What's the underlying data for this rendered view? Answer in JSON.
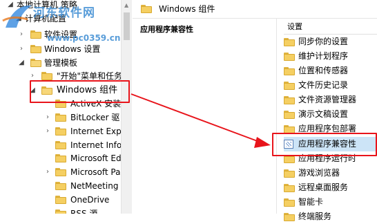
{
  "tree": {
    "items": [
      {
        "label": "本地计算机 策略",
        "expanded": true
      },
      {
        "label": "计算机配置",
        "expanded": true
      },
      {
        "label": "软件设置",
        "expanded": false
      },
      {
        "label": "Windows 设置",
        "expanded": false
      },
      {
        "label": "管理模板",
        "expanded": true
      },
      {
        "label": "\"开始\"菜单和任务",
        "expanded": false
      },
      {
        "label": "Windows 组件",
        "expanded": true
      },
      {
        "label": "ActiveX 安装",
        "expanded": false
      },
      {
        "label": "BitLocker 驱",
        "expanded": false
      },
      {
        "label": "Internet Expl",
        "expanded": false
      },
      {
        "label": "Internet Info",
        "expanded": false
      },
      {
        "label": "Microsoft Ed",
        "expanded": false
      },
      {
        "label": "Microsoft Pa",
        "expanded": false
      },
      {
        "label": "NetMeeting",
        "expanded": false
      },
      {
        "label": "OneDrive",
        "expanded": false
      },
      {
        "label": "RSS 源",
        "expanded": false
      }
    ]
  },
  "breadcrumb": {
    "title": "Windows 组件"
  },
  "detail": {
    "title": "应用程序兼容性"
  },
  "settings": {
    "header": "设置",
    "items": [
      {
        "label": "同步你的设置"
      },
      {
        "label": "维护计划程序"
      },
      {
        "label": "位置和传感器"
      },
      {
        "label": "文件历史记录"
      },
      {
        "label": "文件资源管理器"
      },
      {
        "label": "演示文稿设置"
      },
      {
        "label": "应用程序包部署"
      },
      {
        "label": "应用程序兼容性"
      },
      {
        "label": "应用程序运行时"
      },
      {
        "label": "游戏浏览器"
      },
      {
        "label": "远程桌面服务"
      },
      {
        "label": "智能卡"
      },
      {
        "label": "终端服务"
      }
    ]
  },
  "watermark": {
    "text": "河东软件网",
    "url": "www.pc0359.cn"
  },
  "colors": {
    "highlight": "#e8141b",
    "folder": "#f5cf62",
    "selection": "#cce4f7"
  }
}
